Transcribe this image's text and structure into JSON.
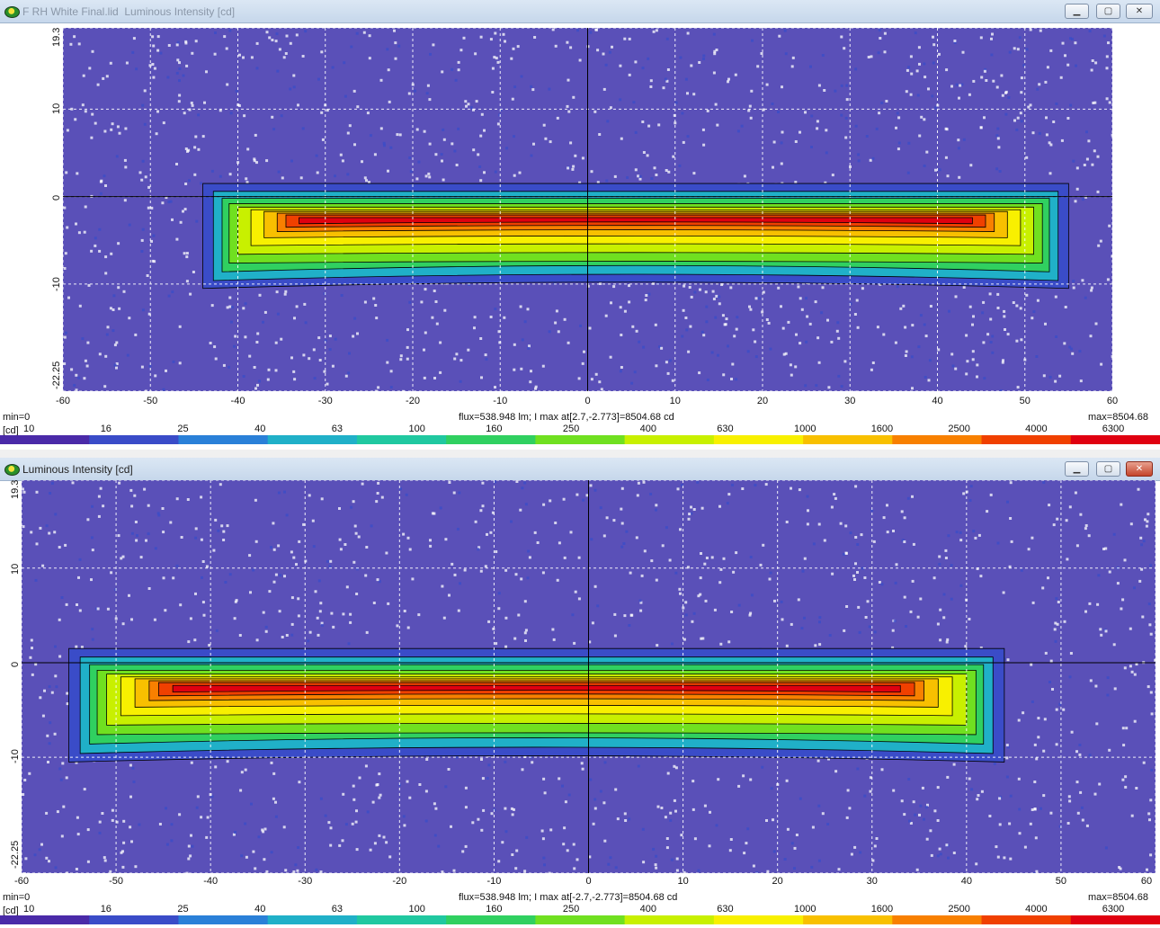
{
  "windows": [
    {
      "id": "top",
      "title": "F RH White Final.lid  Luminous Intensity [cd]",
      "y_labels": [
        "19.3",
        "10",
        "0",
        "-10",
        "-22.25"
      ],
      "x_labels": [
        "-60",
        "-50",
        "-40",
        "-30",
        "-20",
        "-10",
        "0",
        "10",
        "20",
        "30",
        "40",
        "50",
        "60"
      ],
      "min_label": "min=0",
      "max_label": "max=8504.68",
      "info_text": "flux=538.948 lm; I max at[2.7,-2.773]=8504.68 cd",
      "unit_label": "[cd]",
      "colorbar_labels": [
        "10",
        "16",
        "25",
        "40",
        "63",
        "100",
        "160",
        "250",
        "400",
        "630",
        "1000",
        "1600",
        "2500",
        "4000",
        "6300"
      ],
      "beam": {
        "x_start": -44,
        "x_end": 55,
        "hot_x": [
          -35,
          40
        ]
      }
    },
    {
      "id": "bottom",
      "title": "Luminous Intensity [cd]",
      "y_labels": [
        "19.3",
        "10",
        "0",
        "-10",
        "-22.25"
      ],
      "x_labels": [
        "-60",
        "-50",
        "-40",
        "-30",
        "-20",
        "-10",
        "0",
        "10",
        "20",
        "30",
        "40",
        "50",
        "60"
      ],
      "min_label": "min=0",
      "max_label": "max=8504.68",
      "info_text": "flux=538.948 lm; I max at[-2.7,-2.773]=8504.68 cd",
      "unit_label": "[cd]",
      "colorbar_labels": [
        "10",
        "16",
        "25",
        "40",
        "63",
        "100",
        "160",
        "250",
        "400",
        "630",
        "1000",
        "1600",
        "2500",
        "4000",
        "6300"
      ],
      "beam": {
        "x_start": -55,
        "x_end": 44,
        "hot_x": [
          -40,
          35
        ]
      }
    }
  ],
  "chart_data": [
    {
      "type": "heatmap",
      "title": "Luminous Intensity [cd]",
      "xlim": [
        -60,
        60
      ],
      "ylim": [
        -22.25,
        19.3
      ],
      "x_ticks": [
        -60,
        -50,
        -40,
        -30,
        -20,
        -10,
        0,
        10,
        20,
        30,
        40,
        50,
        60
      ],
      "y_ticks": [
        19.3,
        10,
        0,
        -10,
        -22.25
      ],
      "max_cd": 8504.68,
      "max_at": [
        2.7,
        -2.773
      ],
      "flux_lm": 538.948,
      "color_scale": [
        10,
        16,
        25,
        40,
        63,
        100,
        160,
        250,
        400,
        630,
        1000,
        1600,
        2500,
        4000,
        6300
      ]
    },
    {
      "type": "heatmap",
      "title": "Luminous Intensity [cd]",
      "xlim": [
        -60,
        60
      ],
      "ylim": [
        -22.25,
        19.3
      ],
      "x_ticks": [
        -60,
        -50,
        -40,
        -30,
        -20,
        -10,
        0,
        10,
        20,
        30,
        40,
        50,
        60
      ],
      "y_ticks": [
        19.3,
        10,
        0,
        -10,
        -22.25
      ],
      "max_cd": 8504.68,
      "max_at": [
        -2.7,
        -2.773
      ],
      "flux_lm": 538.948,
      "color_scale": [
        10,
        16,
        25,
        40,
        63,
        100,
        160,
        250,
        400,
        630,
        1000,
        1600,
        2500,
        4000,
        6300
      ]
    }
  ],
  "colors": {
    "background": "#5a50b8",
    "grid": "#ffffff",
    "colormap": [
      "#4a2aa8",
      "#3a4cc8",
      "#2a80d8",
      "#20b0c8",
      "#20c8a0",
      "#30d060",
      "#70e020",
      "#c8f000",
      "#f8f000",
      "#f8c000",
      "#f88000",
      "#f04000",
      "#e00010"
    ]
  }
}
